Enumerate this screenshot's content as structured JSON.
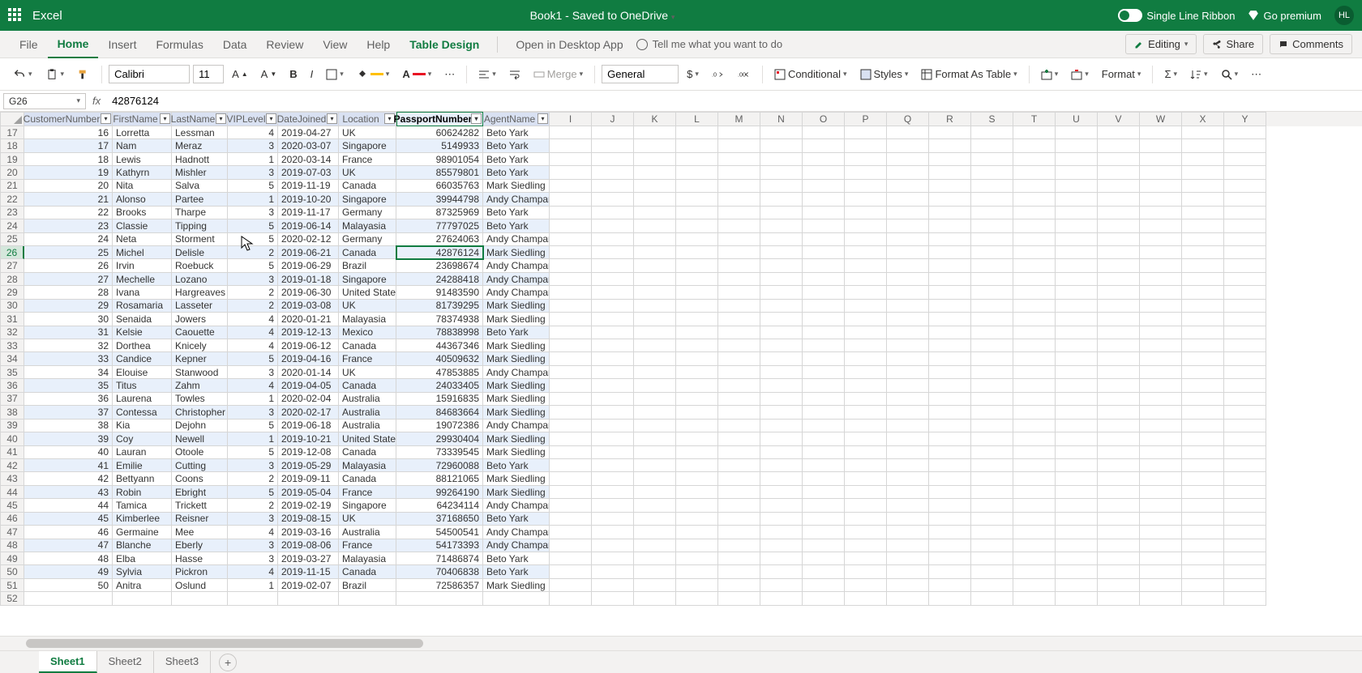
{
  "app_name": "Excel",
  "doc_title": "Book1 - Saved to OneDrive",
  "single_line": "Single Line Ribbon",
  "go_premium": "Go premium",
  "user_initials": "HL",
  "tabs": [
    "File",
    "Home",
    "Insert",
    "Formulas",
    "Data",
    "Review",
    "View",
    "Help",
    "Table Design"
  ],
  "open_desktop": "Open in Desktop App",
  "tell_me": "Tell me what you want to do",
  "editing": "Editing",
  "share": "Share",
  "comments": "Comments",
  "font_name": "Calibri",
  "font_size": "11",
  "merge": "Merge",
  "num_format": "General",
  "conditional": "Conditional",
  "styles": "Styles",
  "format_table": "Format As Table",
  "format": "Format",
  "name_box": "G26",
  "formula_value": "42876124",
  "col_widths": {
    "A": 109,
    "B": 73,
    "C": 69,
    "D": 62,
    "E": 75,
    "F": 71,
    "G": 107,
    "H": 82
  },
  "extra_cols": [
    "I",
    "J",
    "K",
    "L",
    "M",
    "N",
    "O",
    "P",
    "Q",
    "R",
    "S",
    "T",
    "U",
    "V",
    "W",
    "X",
    "Y"
  ],
  "table_headers": [
    "CustomerNumber",
    "FirstName",
    "LastName",
    "VIPLevel",
    "DateJoined",
    "Location",
    "PassportNumber",
    "AgentName"
  ],
  "active_header": "PassportNumber",
  "active_row": 26,
  "active_cell": "G26",
  "rows": [
    {
      "n": 17,
      "v": [
        16,
        "Lorretta",
        "Lessman",
        4,
        "2019-04-27",
        "UK",
        60624282,
        "Beto Yark"
      ]
    },
    {
      "n": 18,
      "v": [
        17,
        "Nam",
        "Meraz",
        3,
        "2020-03-07",
        "Singapore",
        5149933,
        "Beto Yark"
      ]
    },
    {
      "n": 19,
      "v": [
        18,
        "Lewis",
        "Hadnott",
        1,
        "2020-03-14",
        "France",
        98901054,
        "Beto Yark"
      ]
    },
    {
      "n": 20,
      "v": [
        19,
        "Kathyrn",
        "Mishler",
        3,
        "2019-07-03",
        "UK",
        85579801,
        "Beto Yark"
      ]
    },
    {
      "n": 21,
      "v": [
        20,
        "Nita",
        "Salva",
        5,
        "2019-11-19",
        "Canada",
        66035763,
        "Mark Siedling"
      ]
    },
    {
      "n": 22,
      "v": [
        21,
        "Alonso",
        "Partee",
        1,
        "2019-10-20",
        "Singapore",
        39944798,
        "Andy Champan"
      ]
    },
    {
      "n": 23,
      "v": [
        22,
        "Brooks",
        "Tharpe",
        3,
        "2019-11-17",
        "Germany",
        87325969,
        "Beto Yark"
      ]
    },
    {
      "n": 24,
      "v": [
        23,
        "Classie",
        "Tipping",
        5,
        "2019-06-14",
        "Malayasia",
        77797025,
        "Beto Yark"
      ]
    },
    {
      "n": 25,
      "v": [
        24,
        "Neta",
        "Storment",
        5,
        "2020-02-12",
        "Germany",
        27624063,
        "Andy Champan"
      ]
    },
    {
      "n": 26,
      "v": [
        25,
        "Michel",
        "Delisle",
        2,
        "2019-06-21",
        "Canada",
        42876124,
        "Mark Siedling"
      ]
    },
    {
      "n": 27,
      "v": [
        26,
        "Irvin",
        "Roebuck",
        5,
        "2019-06-29",
        "Brazil",
        23698674,
        "Andy Champan"
      ]
    },
    {
      "n": 28,
      "v": [
        27,
        "Mechelle",
        "Lozano",
        3,
        "2019-01-18",
        "Singapore",
        24288418,
        "Andy Champan"
      ]
    },
    {
      "n": 29,
      "v": [
        28,
        "Ivana",
        "Hargreaves",
        2,
        "2019-06-30",
        "United States",
        91483590,
        "Andy Champan"
      ]
    },
    {
      "n": 30,
      "v": [
        29,
        "Rosamaria",
        "Lasseter",
        2,
        "2019-03-08",
        "UK",
        81739295,
        "Mark Siedling"
      ]
    },
    {
      "n": 31,
      "v": [
        30,
        "Senaida",
        "Jowers",
        4,
        "2020-01-21",
        "Malayasia",
        78374938,
        "Mark Siedling"
      ]
    },
    {
      "n": 32,
      "v": [
        31,
        "Kelsie",
        "Caouette",
        4,
        "2019-12-13",
        "Mexico",
        78838998,
        "Beto Yark"
      ]
    },
    {
      "n": 33,
      "v": [
        32,
        "Dorthea",
        "Knicely",
        4,
        "2019-06-12",
        "Canada",
        44367346,
        "Mark Siedling"
      ]
    },
    {
      "n": 34,
      "v": [
        33,
        "Candice",
        "Kepner",
        5,
        "2019-04-16",
        "France",
        40509632,
        "Mark Siedling"
      ]
    },
    {
      "n": 35,
      "v": [
        34,
        "Elouise",
        "Stanwood",
        3,
        "2020-01-14",
        "UK",
        47853885,
        "Andy Champan"
      ]
    },
    {
      "n": 36,
      "v": [
        35,
        "Titus",
        "Zahm",
        4,
        "2019-04-05",
        "Canada",
        24033405,
        "Mark Siedling"
      ]
    },
    {
      "n": 37,
      "v": [
        36,
        "Laurena",
        "Towles",
        1,
        "2020-02-04",
        "Australia",
        15916835,
        "Mark Siedling"
      ]
    },
    {
      "n": 38,
      "v": [
        37,
        "Contessa",
        "Christopher",
        3,
        "2020-02-17",
        "Australia",
        84683664,
        "Mark Siedling"
      ]
    },
    {
      "n": 39,
      "v": [
        38,
        "Kia",
        "Dejohn",
        5,
        "2019-06-18",
        "Australia",
        19072386,
        "Andy Champan"
      ]
    },
    {
      "n": 40,
      "v": [
        39,
        "Coy",
        "Newell",
        1,
        "2019-10-21",
        "United States",
        29930404,
        "Mark Siedling"
      ]
    },
    {
      "n": 41,
      "v": [
        40,
        "Lauran",
        "Otoole",
        5,
        "2019-12-08",
        "Canada",
        73339545,
        "Mark Siedling"
      ]
    },
    {
      "n": 42,
      "v": [
        41,
        "Emilie",
        "Cutting",
        3,
        "2019-05-29",
        "Malayasia",
        72960088,
        "Beto Yark"
      ]
    },
    {
      "n": 43,
      "v": [
        42,
        "Bettyann",
        "Coons",
        2,
        "2019-09-11",
        "Canada",
        88121065,
        "Mark Siedling"
      ]
    },
    {
      "n": 44,
      "v": [
        43,
        "Robin",
        "Ebright",
        5,
        "2019-05-04",
        "France",
        99264190,
        "Mark Siedling"
      ]
    },
    {
      "n": 45,
      "v": [
        44,
        "Tamica",
        "Trickett",
        2,
        "2019-02-19",
        "Singapore",
        64234114,
        "Andy Champan"
      ]
    },
    {
      "n": 46,
      "v": [
        45,
        "Kimberlee",
        "Reisner",
        3,
        "2019-08-15",
        "UK",
        37168650,
        "Beto Yark"
      ]
    },
    {
      "n": 47,
      "v": [
        46,
        "Germaine",
        "Mee",
        4,
        "2019-03-16",
        "Australia",
        54500541,
        "Andy Champan"
      ]
    },
    {
      "n": 48,
      "v": [
        47,
        "Blanche",
        "Eberly",
        3,
        "2019-08-06",
        "France",
        54173393,
        "Andy Champan"
      ]
    },
    {
      "n": 49,
      "v": [
        48,
        "Elba",
        "Hasse",
        3,
        "2019-03-27",
        "Malayasia",
        71486874,
        "Beto Yark"
      ]
    },
    {
      "n": 50,
      "v": [
        49,
        "Sylvia",
        "Pickron",
        4,
        "2019-11-15",
        "Canada",
        70406838,
        "Beto Yark"
      ]
    },
    {
      "n": 51,
      "v": [
        50,
        "Anitra",
        "Oslund",
        1,
        "2019-02-07",
        "Brazil",
        72586357,
        "Mark Siedling"
      ]
    },
    {
      "n": 52,
      "v": [
        "",
        "",
        "",
        "",
        "",
        "",
        "",
        ""
      ]
    }
  ],
  "sheets": [
    "Sheet1",
    "Sheet2",
    "Sheet3"
  ]
}
